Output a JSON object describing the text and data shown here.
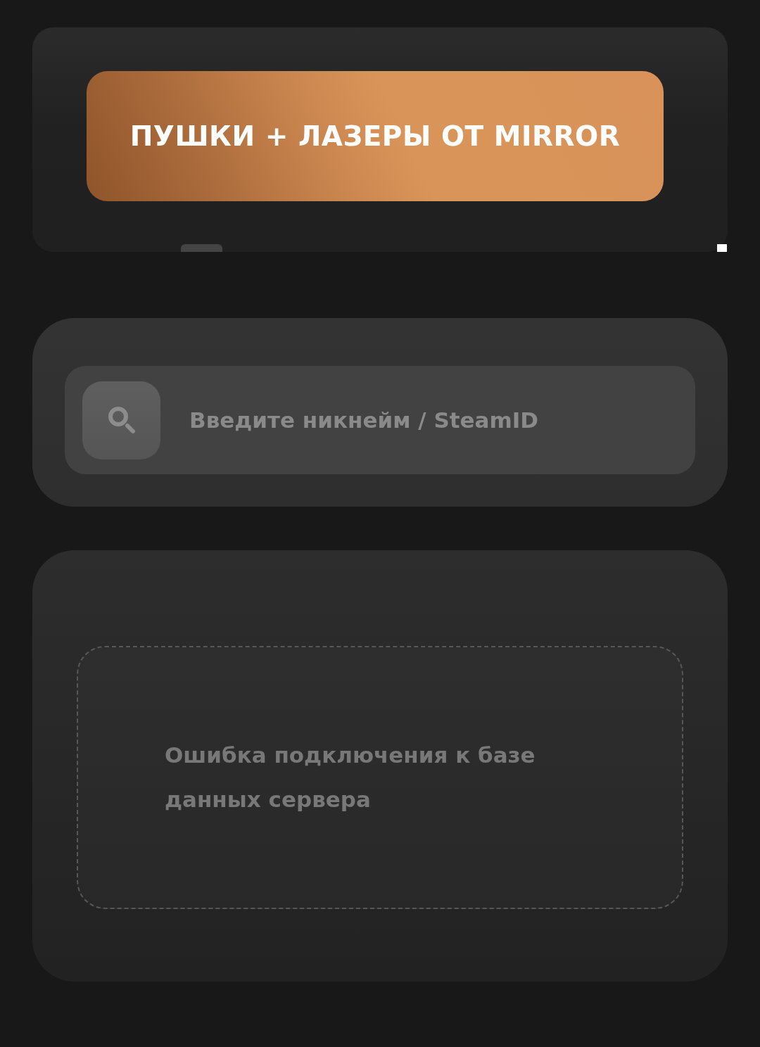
{
  "banner": {
    "title": "ПУШКИ + ЛАЗЕРЫ ОТ MIRROR"
  },
  "search": {
    "placeholder": "Введите никнейм / SteamID"
  },
  "results": {
    "message": "Ошибка подключения к базе данных сервера"
  }
}
